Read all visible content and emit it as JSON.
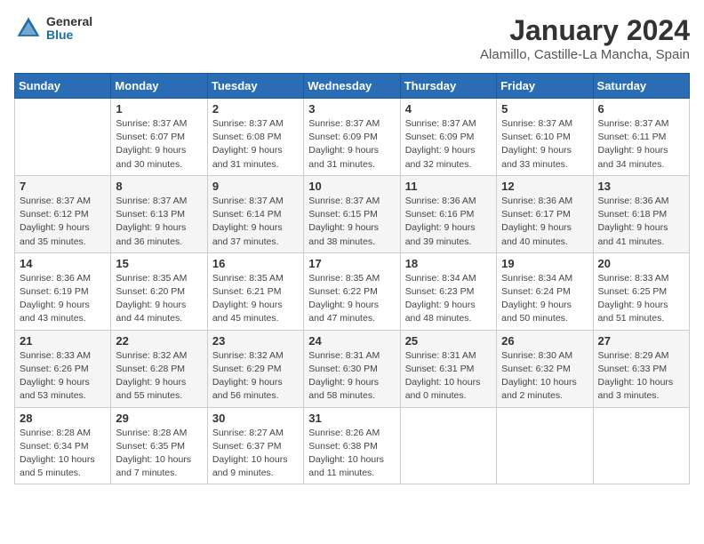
{
  "logo": {
    "general": "General",
    "blue": "Blue"
  },
  "title": "January 2024",
  "subtitle": "Alamillo, Castille-La Mancha, Spain",
  "weekdays": [
    "Sunday",
    "Monday",
    "Tuesday",
    "Wednesday",
    "Thursday",
    "Friday",
    "Saturday"
  ],
  "weeks": [
    [
      {
        "day": null
      },
      {
        "day": 1,
        "sunrise": "Sunrise: 8:37 AM",
        "sunset": "Sunset: 6:07 PM",
        "daylight": "Daylight: 9 hours and 30 minutes."
      },
      {
        "day": 2,
        "sunrise": "Sunrise: 8:37 AM",
        "sunset": "Sunset: 6:08 PM",
        "daylight": "Daylight: 9 hours and 31 minutes."
      },
      {
        "day": 3,
        "sunrise": "Sunrise: 8:37 AM",
        "sunset": "Sunset: 6:09 PM",
        "daylight": "Daylight: 9 hours and 31 minutes."
      },
      {
        "day": 4,
        "sunrise": "Sunrise: 8:37 AM",
        "sunset": "Sunset: 6:09 PM",
        "daylight": "Daylight: 9 hours and 32 minutes."
      },
      {
        "day": 5,
        "sunrise": "Sunrise: 8:37 AM",
        "sunset": "Sunset: 6:10 PM",
        "daylight": "Daylight: 9 hours and 33 minutes."
      },
      {
        "day": 6,
        "sunrise": "Sunrise: 8:37 AM",
        "sunset": "Sunset: 6:11 PM",
        "daylight": "Daylight: 9 hours and 34 minutes."
      }
    ],
    [
      {
        "day": 7,
        "sunrise": "Sunrise: 8:37 AM",
        "sunset": "Sunset: 6:12 PM",
        "daylight": "Daylight: 9 hours and 35 minutes."
      },
      {
        "day": 8,
        "sunrise": "Sunrise: 8:37 AM",
        "sunset": "Sunset: 6:13 PM",
        "daylight": "Daylight: 9 hours and 36 minutes."
      },
      {
        "day": 9,
        "sunrise": "Sunrise: 8:37 AM",
        "sunset": "Sunset: 6:14 PM",
        "daylight": "Daylight: 9 hours and 37 minutes."
      },
      {
        "day": 10,
        "sunrise": "Sunrise: 8:37 AM",
        "sunset": "Sunset: 6:15 PM",
        "daylight": "Daylight: 9 hours and 38 minutes."
      },
      {
        "day": 11,
        "sunrise": "Sunrise: 8:36 AM",
        "sunset": "Sunset: 6:16 PM",
        "daylight": "Daylight: 9 hours and 39 minutes."
      },
      {
        "day": 12,
        "sunrise": "Sunrise: 8:36 AM",
        "sunset": "Sunset: 6:17 PM",
        "daylight": "Daylight: 9 hours and 40 minutes."
      },
      {
        "day": 13,
        "sunrise": "Sunrise: 8:36 AM",
        "sunset": "Sunset: 6:18 PM",
        "daylight": "Daylight: 9 hours and 41 minutes."
      }
    ],
    [
      {
        "day": 14,
        "sunrise": "Sunrise: 8:36 AM",
        "sunset": "Sunset: 6:19 PM",
        "daylight": "Daylight: 9 hours and 43 minutes."
      },
      {
        "day": 15,
        "sunrise": "Sunrise: 8:35 AM",
        "sunset": "Sunset: 6:20 PM",
        "daylight": "Daylight: 9 hours and 44 minutes."
      },
      {
        "day": 16,
        "sunrise": "Sunrise: 8:35 AM",
        "sunset": "Sunset: 6:21 PM",
        "daylight": "Daylight: 9 hours and 45 minutes."
      },
      {
        "day": 17,
        "sunrise": "Sunrise: 8:35 AM",
        "sunset": "Sunset: 6:22 PM",
        "daylight": "Daylight: 9 hours and 47 minutes."
      },
      {
        "day": 18,
        "sunrise": "Sunrise: 8:34 AM",
        "sunset": "Sunset: 6:23 PM",
        "daylight": "Daylight: 9 hours and 48 minutes."
      },
      {
        "day": 19,
        "sunrise": "Sunrise: 8:34 AM",
        "sunset": "Sunset: 6:24 PM",
        "daylight": "Daylight: 9 hours and 50 minutes."
      },
      {
        "day": 20,
        "sunrise": "Sunrise: 8:33 AM",
        "sunset": "Sunset: 6:25 PM",
        "daylight": "Daylight: 9 hours and 51 minutes."
      }
    ],
    [
      {
        "day": 21,
        "sunrise": "Sunrise: 8:33 AM",
        "sunset": "Sunset: 6:26 PM",
        "daylight": "Daylight: 9 hours and 53 minutes."
      },
      {
        "day": 22,
        "sunrise": "Sunrise: 8:32 AM",
        "sunset": "Sunset: 6:28 PM",
        "daylight": "Daylight: 9 hours and 55 minutes."
      },
      {
        "day": 23,
        "sunrise": "Sunrise: 8:32 AM",
        "sunset": "Sunset: 6:29 PM",
        "daylight": "Daylight: 9 hours and 56 minutes."
      },
      {
        "day": 24,
        "sunrise": "Sunrise: 8:31 AM",
        "sunset": "Sunset: 6:30 PM",
        "daylight": "Daylight: 9 hours and 58 minutes."
      },
      {
        "day": 25,
        "sunrise": "Sunrise: 8:31 AM",
        "sunset": "Sunset: 6:31 PM",
        "daylight": "Daylight: 10 hours and 0 minutes."
      },
      {
        "day": 26,
        "sunrise": "Sunrise: 8:30 AM",
        "sunset": "Sunset: 6:32 PM",
        "daylight": "Daylight: 10 hours and 2 minutes."
      },
      {
        "day": 27,
        "sunrise": "Sunrise: 8:29 AM",
        "sunset": "Sunset: 6:33 PM",
        "daylight": "Daylight: 10 hours and 3 minutes."
      }
    ],
    [
      {
        "day": 28,
        "sunrise": "Sunrise: 8:28 AM",
        "sunset": "Sunset: 6:34 PM",
        "daylight": "Daylight: 10 hours and 5 minutes."
      },
      {
        "day": 29,
        "sunrise": "Sunrise: 8:28 AM",
        "sunset": "Sunset: 6:35 PM",
        "daylight": "Daylight: 10 hours and 7 minutes."
      },
      {
        "day": 30,
        "sunrise": "Sunrise: 8:27 AM",
        "sunset": "Sunset: 6:37 PM",
        "daylight": "Daylight: 10 hours and 9 minutes."
      },
      {
        "day": 31,
        "sunrise": "Sunrise: 8:26 AM",
        "sunset": "Sunset: 6:38 PM",
        "daylight": "Daylight: 10 hours and 11 minutes."
      },
      {
        "day": null
      },
      {
        "day": null
      },
      {
        "day": null
      }
    ]
  ]
}
